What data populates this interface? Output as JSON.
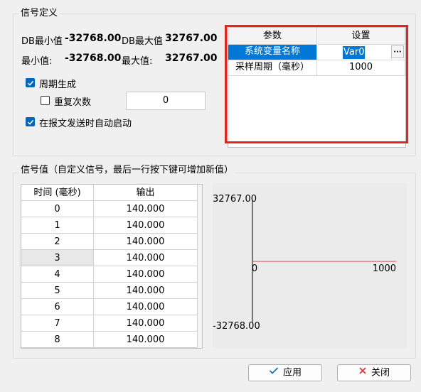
{
  "signal_def": {
    "title": "信号定义",
    "db_min_label": "DB最小值",
    "db_min_value": "-32768.00",
    "db_max_label": "DB最大值",
    "db_max_value": "32767.00",
    "min_label": "最小值:",
    "min_value": "-32768.00",
    "max_label": "最大值:",
    "max_value": "32767.00",
    "periodic_label": "周期生成",
    "periodic_checked": true,
    "repeat_label": "重复次数",
    "repeat_checked": false,
    "repeat_value": "0",
    "autostart_label": "在报文发送时自动启动",
    "autostart_checked": true
  },
  "param_grid": {
    "headers": [
      "参数",
      "设置"
    ],
    "rows": [
      {
        "name": "系统变量名称",
        "value": "Var0",
        "selected": true
      },
      {
        "name": "采样周期（毫秒）",
        "value": "1000",
        "selected": false
      }
    ],
    "ellipsis": "···"
  },
  "signal_values": {
    "title": "信号值（自定义信号，最后一行按下键可增加新值）",
    "headers": [
      "时间 (毫秒)",
      "输出"
    ],
    "rows": [
      {
        "time": "0",
        "output": "140.000"
      },
      {
        "time": "1",
        "output": "140.000"
      },
      {
        "time": "2",
        "output": "140.000"
      },
      {
        "time": "3",
        "output": "140.000"
      },
      {
        "time": "4",
        "output": "140.000"
      },
      {
        "time": "5",
        "output": "140.000"
      },
      {
        "time": "6",
        "output": "140.000"
      },
      {
        "time": "7",
        "output": "140.000"
      },
      {
        "time": "8",
        "output": "140.000"
      }
    ],
    "selected_row": 3
  },
  "chart_data": {
    "type": "line",
    "x": [
      0,
      1000
    ],
    "series": [
      {
        "values": [
          140,
          140
        ]
      }
    ],
    "ylim": [
      -32768,
      32767
    ],
    "xlim": [
      0,
      1000
    ],
    "y_max_label": "32767.00",
    "y_min_label": "-32768.00",
    "x_min_label": "0",
    "x_max_label": "1000",
    "line_color": "#d9534f"
  },
  "buttons": {
    "apply": "应用",
    "close": "关闭",
    "apply_icon": "check-icon",
    "close_icon": "x-icon"
  }
}
